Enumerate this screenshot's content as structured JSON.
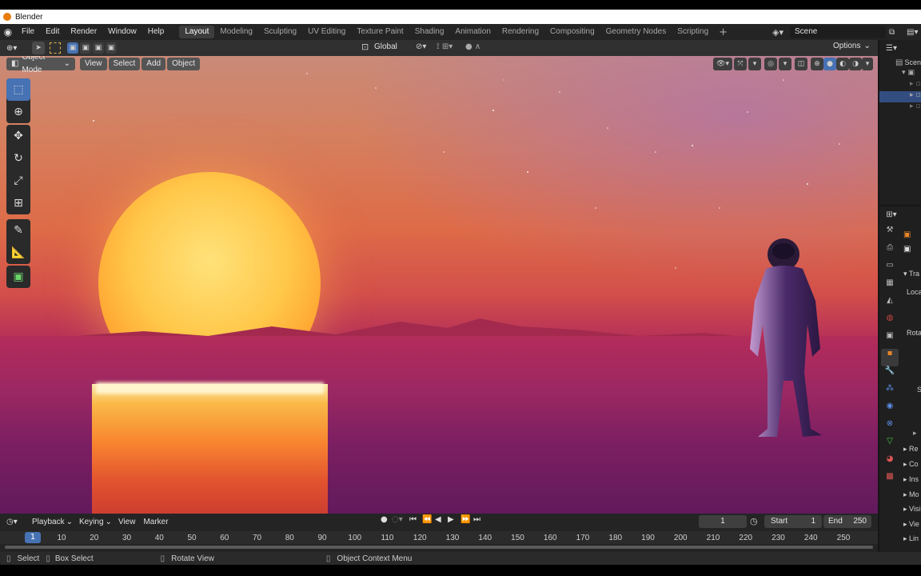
{
  "window": {
    "title": "Blender"
  },
  "menu": [
    "File",
    "Edit",
    "Render",
    "Window",
    "Help"
  ],
  "workspaces": [
    "Layout",
    "Modeling",
    "Sculpting",
    "UV Editing",
    "Texture Paint",
    "Shading",
    "Animation",
    "Rendering",
    "Compositing",
    "Geometry Nodes",
    "Scripting"
  ],
  "active_workspace": "Layout",
  "scene_name": "Scene",
  "header": {
    "mode": "Object Mode",
    "view": "View",
    "select": "Select",
    "add": "Add",
    "object": "Object",
    "transform_orientation": "Global",
    "options": "Options"
  },
  "outliner": {
    "root_label": "Scen"
  },
  "properties": {
    "labels": [
      "Tra",
      "Loca",
      "Rota",
      "S",
      "Re",
      "Co",
      "Ins",
      "Mo",
      "Visi",
      "Vie",
      "Lin"
    ]
  },
  "timeline": {
    "playback": "Playback",
    "keying": "Keying",
    "view": "View",
    "marker": "Marker",
    "current_frame": "1",
    "start_label": "Start",
    "start": "1",
    "end_label": "End",
    "end": "250",
    "ruler": [
      "10",
      "20",
      "30",
      "40",
      "50",
      "60",
      "70",
      "80",
      "90",
      "100",
      "110",
      "120",
      "130",
      "140",
      "150",
      "160",
      "170",
      "180",
      "190",
      "200",
      "210",
      "220",
      "230",
      "240",
      "250"
    ],
    "playhead": "1"
  },
  "statusbar": {
    "select": "Select",
    "box_select": "Box Select",
    "rotate_view": "Rotate View",
    "context_menu": "Object Context Menu"
  },
  "colors": {
    "accent": "#4772b3",
    "panel": "#303030",
    "topbar": "#242424"
  }
}
